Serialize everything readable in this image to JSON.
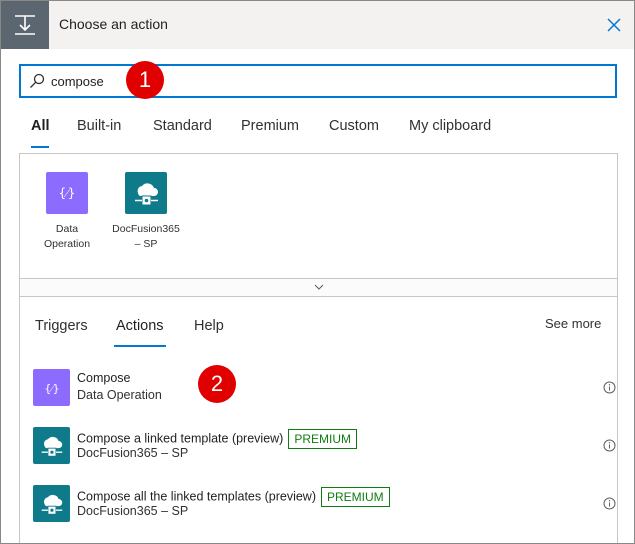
{
  "header": {
    "title": "Choose an action",
    "icon": "operation-icon",
    "close_icon": "close-icon"
  },
  "search": {
    "value": "compose",
    "placeholder": "",
    "icon": "search-icon"
  },
  "badges": {
    "first": "1",
    "second": "2"
  },
  "tabs": [
    {
      "label": "All",
      "active": true
    },
    {
      "label": "Built-in"
    },
    {
      "label": "Standard"
    },
    {
      "label": "Premium"
    },
    {
      "label": "Custom"
    },
    {
      "label": "My clipboard"
    }
  ],
  "connectors": [
    {
      "label": "Data Operation",
      "color": "#8c6cff",
      "icon": "data-operation-icon"
    },
    {
      "label": "DocFusion365 – SP",
      "color": "#0f7a8a",
      "icon": "docfusion-icon"
    }
  ],
  "sub_tabs": {
    "triggers": "Triggers",
    "actions": "Actions",
    "help": "Help",
    "see_more": "See more"
  },
  "actions": [
    {
      "title": "Compose",
      "subtitle": "Data Operation",
      "premium": "",
      "color": "#8c6cff"
    },
    {
      "title": "Compose a linked template (preview)",
      "subtitle": "DocFusion365 – SP",
      "premium": "PREMIUM",
      "color": "#0f7a8a"
    },
    {
      "title": "Compose all the linked templates (preview)",
      "subtitle": "DocFusion365 – SP",
      "premium": "PREMIUM",
      "color": "#0f7a8a"
    }
  ],
  "colors": {
    "accent": "#0078d4",
    "badge": "#e00000",
    "premium": "#107c10"
  }
}
